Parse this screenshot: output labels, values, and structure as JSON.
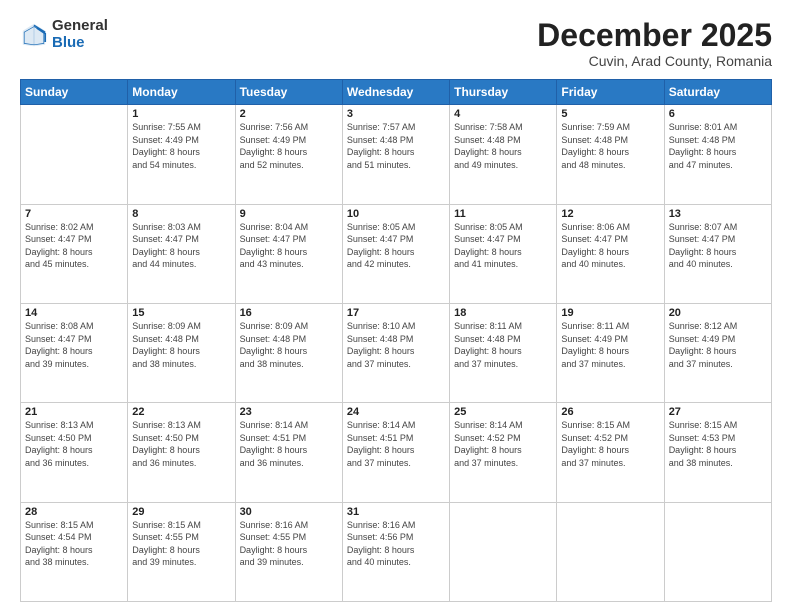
{
  "header": {
    "logo_general": "General",
    "logo_blue": "Blue",
    "title": "December 2025",
    "subtitle": "Cuvin, Arad County, Romania"
  },
  "days_of_week": [
    "Sunday",
    "Monday",
    "Tuesday",
    "Wednesday",
    "Thursday",
    "Friday",
    "Saturday"
  ],
  "weeks": [
    [
      {
        "num": "",
        "sunrise": "",
        "sunset": "",
        "daylight": "",
        "empty": true
      },
      {
        "num": "1",
        "sunrise": "Sunrise: 7:55 AM",
        "sunset": "Sunset: 4:49 PM",
        "daylight": "Daylight: 8 hours and 54 minutes."
      },
      {
        "num": "2",
        "sunrise": "Sunrise: 7:56 AM",
        "sunset": "Sunset: 4:49 PM",
        "daylight": "Daylight: 8 hours and 52 minutes."
      },
      {
        "num": "3",
        "sunrise": "Sunrise: 7:57 AM",
        "sunset": "Sunset: 4:48 PM",
        "daylight": "Daylight: 8 hours and 51 minutes."
      },
      {
        "num": "4",
        "sunrise": "Sunrise: 7:58 AM",
        "sunset": "Sunset: 4:48 PM",
        "daylight": "Daylight: 8 hours and 49 minutes."
      },
      {
        "num": "5",
        "sunrise": "Sunrise: 7:59 AM",
        "sunset": "Sunset: 4:48 PM",
        "daylight": "Daylight: 8 hours and 48 minutes."
      },
      {
        "num": "6",
        "sunrise": "Sunrise: 8:01 AM",
        "sunset": "Sunset: 4:48 PM",
        "daylight": "Daylight: 8 hours and 47 minutes."
      }
    ],
    [
      {
        "num": "7",
        "sunrise": "Sunrise: 8:02 AM",
        "sunset": "Sunset: 4:47 PM",
        "daylight": "Daylight: 8 hours and 45 minutes."
      },
      {
        "num": "8",
        "sunrise": "Sunrise: 8:03 AM",
        "sunset": "Sunset: 4:47 PM",
        "daylight": "Daylight: 8 hours and 44 minutes."
      },
      {
        "num": "9",
        "sunrise": "Sunrise: 8:04 AM",
        "sunset": "Sunset: 4:47 PM",
        "daylight": "Daylight: 8 hours and 43 minutes."
      },
      {
        "num": "10",
        "sunrise": "Sunrise: 8:05 AM",
        "sunset": "Sunset: 4:47 PM",
        "daylight": "Daylight: 8 hours and 42 minutes."
      },
      {
        "num": "11",
        "sunrise": "Sunrise: 8:05 AM",
        "sunset": "Sunset: 4:47 PM",
        "daylight": "Daylight: 8 hours and 41 minutes."
      },
      {
        "num": "12",
        "sunrise": "Sunrise: 8:06 AM",
        "sunset": "Sunset: 4:47 PM",
        "daylight": "Daylight: 8 hours and 40 minutes."
      },
      {
        "num": "13",
        "sunrise": "Sunrise: 8:07 AM",
        "sunset": "Sunset: 4:47 PM",
        "daylight": "Daylight: 8 hours and 40 minutes."
      }
    ],
    [
      {
        "num": "14",
        "sunrise": "Sunrise: 8:08 AM",
        "sunset": "Sunset: 4:47 PM",
        "daylight": "Daylight: 8 hours and 39 minutes."
      },
      {
        "num": "15",
        "sunrise": "Sunrise: 8:09 AM",
        "sunset": "Sunset: 4:48 PM",
        "daylight": "Daylight: 8 hours and 38 minutes."
      },
      {
        "num": "16",
        "sunrise": "Sunrise: 8:09 AM",
        "sunset": "Sunset: 4:48 PM",
        "daylight": "Daylight: 8 hours and 38 minutes."
      },
      {
        "num": "17",
        "sunrise": "Sunrise: 8:10 AM",
        "sunset": "Sunset: 4:48 PM",
        "daylight": "Daylight: 8 hours and 37 minutes."
      },
      {
        "num": "18",
        "sunrise": "Sunrise: 8:11 AM",
        "sunset": "Sunset: 4:48 PM",
        "daylight": "Daylight: 8 hours and 37 minutes."
      },
      {
        "num": "19",
        "sunrise": "Sunrise: 8:11 AM",
        "sunset": "Sunset: 4:49 PM",
        "daylight": "Daylight: 8 hours and 37 minutes."
      },
      {
        "num": "20",
        "sunrise": "Sunrise: 8:12 AM",
        "sunset": "Sunset: 4:49 PM",
        "daylight": "Daylight: 8 hours and 37 minutes."
      }
    ],
    [
      {
        "num": "21",
        "sunrise": "Sunrise: 8:13 AM",
        "sunset": "Sunset: 4:50 PM",
        "daylight": "Daylight: 8 hours and 36 minutes."
      },
      {
        "num": "22",
        "sunrise": "Sunrise: 8:13 AM",
        "sunset": "Sunset: 4:50 PM",
        "daylight": "Daylight: 8 hours and 36 minutes."
      },
      {
        "num": "23",
        "sunrise": "Sunrise: 8:14 AM",
        "sunset": "Sunset: 4:51 PM",
        "daylight": "Daylight: 8 hours and 36 minutes."
      },
      {
        "num": "24",
        "sunrise": "Sunrise: 8:14 AM",
        "sunset": "Sunset: 4:51 PM",
        "daylight": "Daylight: 8 hours and 37 minutes."
      },
      {
        "num": "25",
        "sunrise": "Sunrise: 8:14 AM",
        "sunset": "Sunset: 4:52 PM",
        "daylight": "Daylight: 8 hours and 37 minutes."
      },
      {
        "num": "26",
        "sunrise": "Sunrise: 8:15 AM",
        "sunset": "Sunset: 4:52 PM",
        "daylight": "Daylight: 8 hours and 37 minutes."
      },
      {
        "num": "27",
        "sunrise": "Sunrise: 8:15 AM",
        "sunset": "Sunset: 4:53 PM",
        "daylight": "Daylight: 8 hours and 38 minutes."
      }
    ],
    [
      {
        "num": "28",
        "sunrise": "Sunrise: 8:15 AM",
        "sunset": "Sunset: 4:54 PM",
        "daylight": "Daylight: 8 hours and 38 minutes."
      },
      {
        "num": "29",
        "sunrise": "Sunrise: 8:15 AM",
        "sunset": "Sunset: 4:55 PM",
        "daylight": "Daylight: 8 hours and 39 minutes."
      },
      {
        "num": "30",
        "sunrise": "Sunrise: 8:16 AM",
        "sunset": "Sunset: 4:55 PM",
        "daylight": "Daylight: 8 hours and 39 minutes."
      },
      {
        "num": "31",
        "sunrise": "Sunrise: 8:16 AM",
        "sunset": "Sunset: 4:56 PM",
        "daylight": "Daylight: 8 hours and 40 minutes."
      },
      {
        "num": "",
        "sunrise": "",
        "sunset": "",
        "daylight": "",
        "empty": true
      },
      {
        "num": "",
        "sunrise": "",
        "sunset": "",
        "daylight": "",
        "empty": true
      },
      {
        "num": "",
        "sunrise": "",
        "sunset": "",
        "daylight": "",
        "empty": true
      }
    ]
  ]
}
